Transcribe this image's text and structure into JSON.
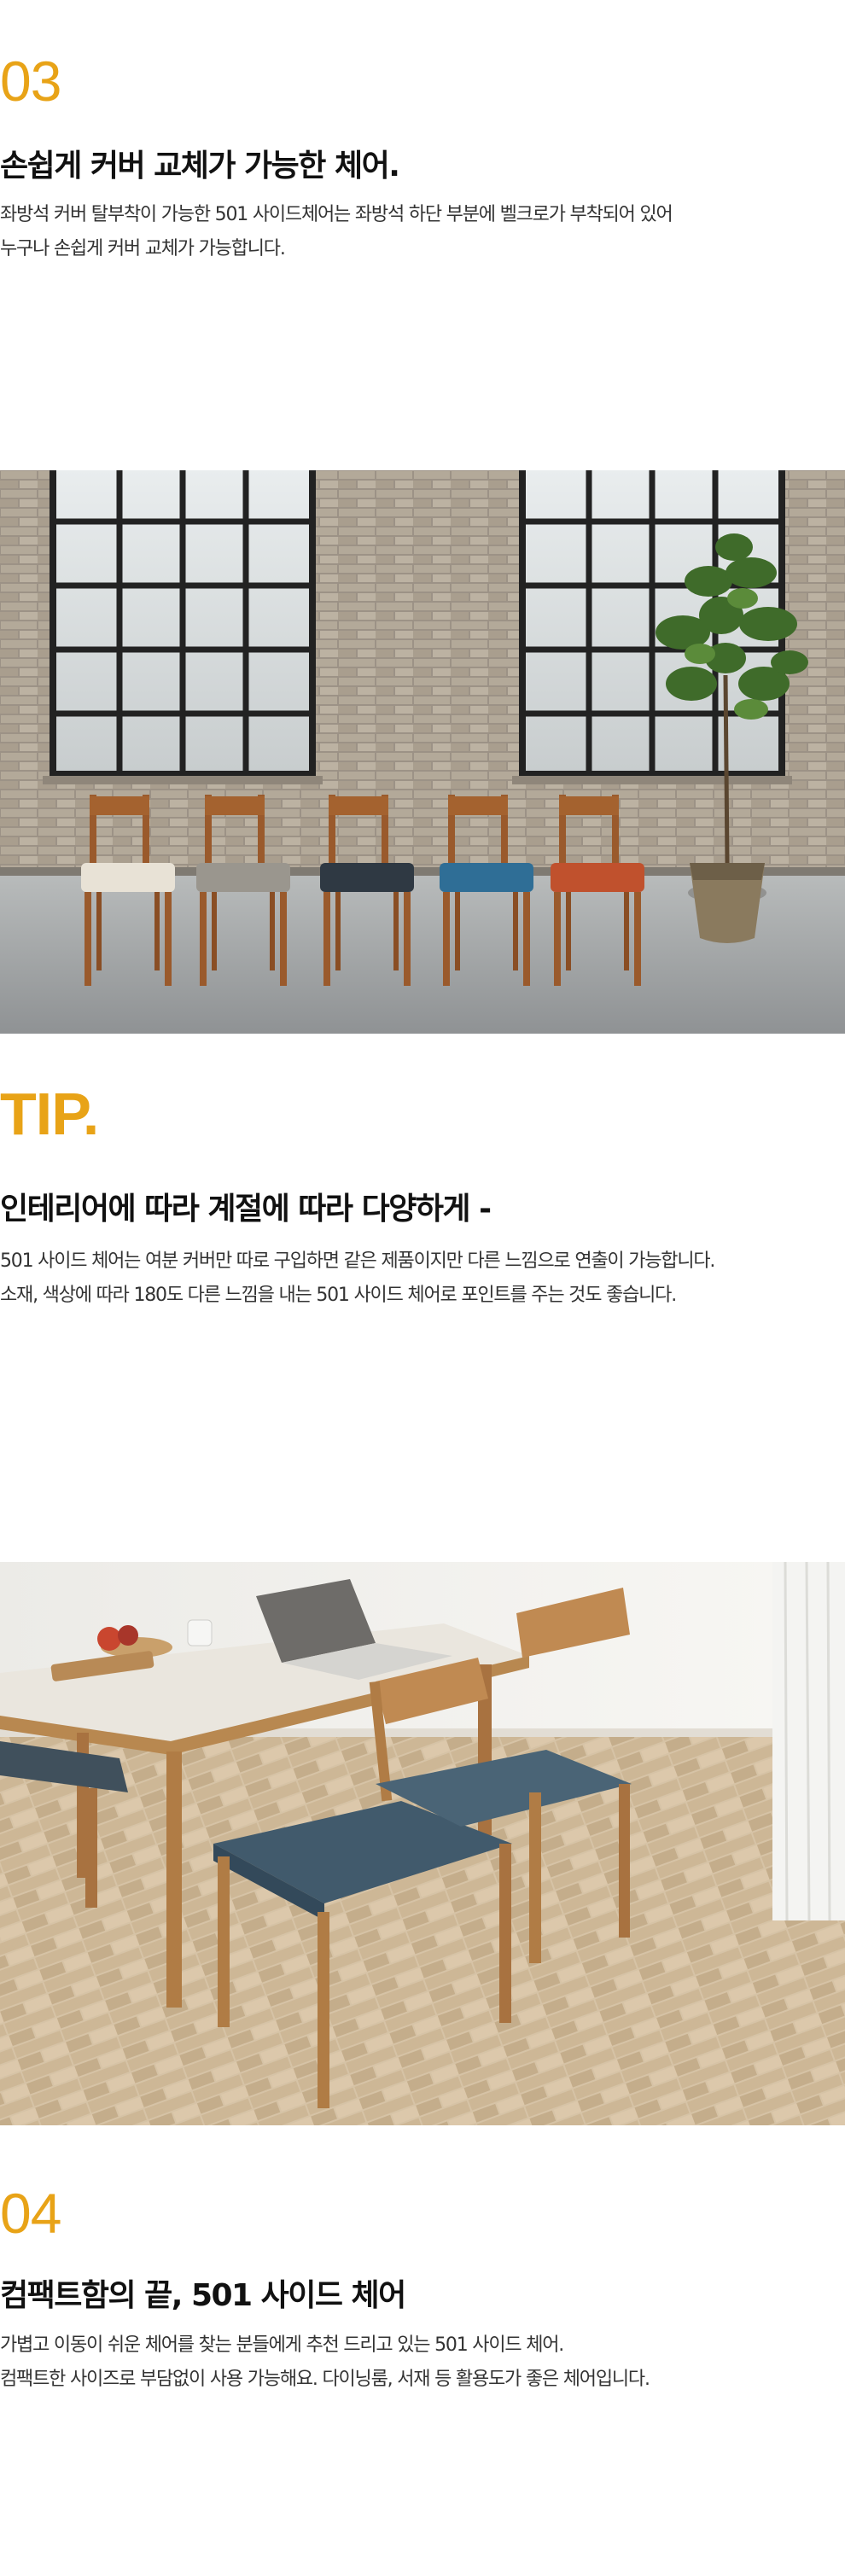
{
  "colors": {
    "accent": "#e8a317",
    "text": "#1a1a1a",
    "body": "#333333"
  },
  "section3": {
    "number": "03",
    "title": "손쉽게 커버 교체가 가능한 체어.",
    "lines": [
      "좌방석 커버 탈부착이 가능한 501 사이드체어는 좌방석 하단 부분에 벨크로가 부착되어 있어",
      "누구나 손쉽게 커버 교체가 가능합니다."
    ]
  },
  "photo1": {
    "name": "five-chairs-brick-wall",
    "chair_seat_colors": [
      "#e8e2d6",
      "#9a968e",
      "#2f3943",
      "#2f6e96",
      "#c0512d"
    ]
  },
  "tip": {
    "label": "TIP.",
    "title": "인테리어에 따라 계절에 따라 다양하게 -",
    "lines": [
      "501 사이드 체어는 여분 커버만 따로 구입하면 같은 제품이지만 다른 느낌으로 연출이 가능합니다.",
      "소재, 색상에 따라 180도 다른 느낌을 내는 501 사이드 체어로 포인트를 주는 것도 좋습니다."
    ]
  },
  "photo2": {
    "name": "dining-table-blue-chairs"
  },
  "section4": {
    "number": "04",
    "title": "컴팩트함의 끝, 501 사이드 체어",
    "lines": [
      "가볍고 이동이 쉬운 체어를 찾는 분들에게 추천 드리고 있는 501 사이드 체어.",
      "컴팩트한 사이즈로 부담없이 사용 가능해요.  다이닝룸, 서재 등 활용도가 좋은 체어입니다."
    ]
  }
}
